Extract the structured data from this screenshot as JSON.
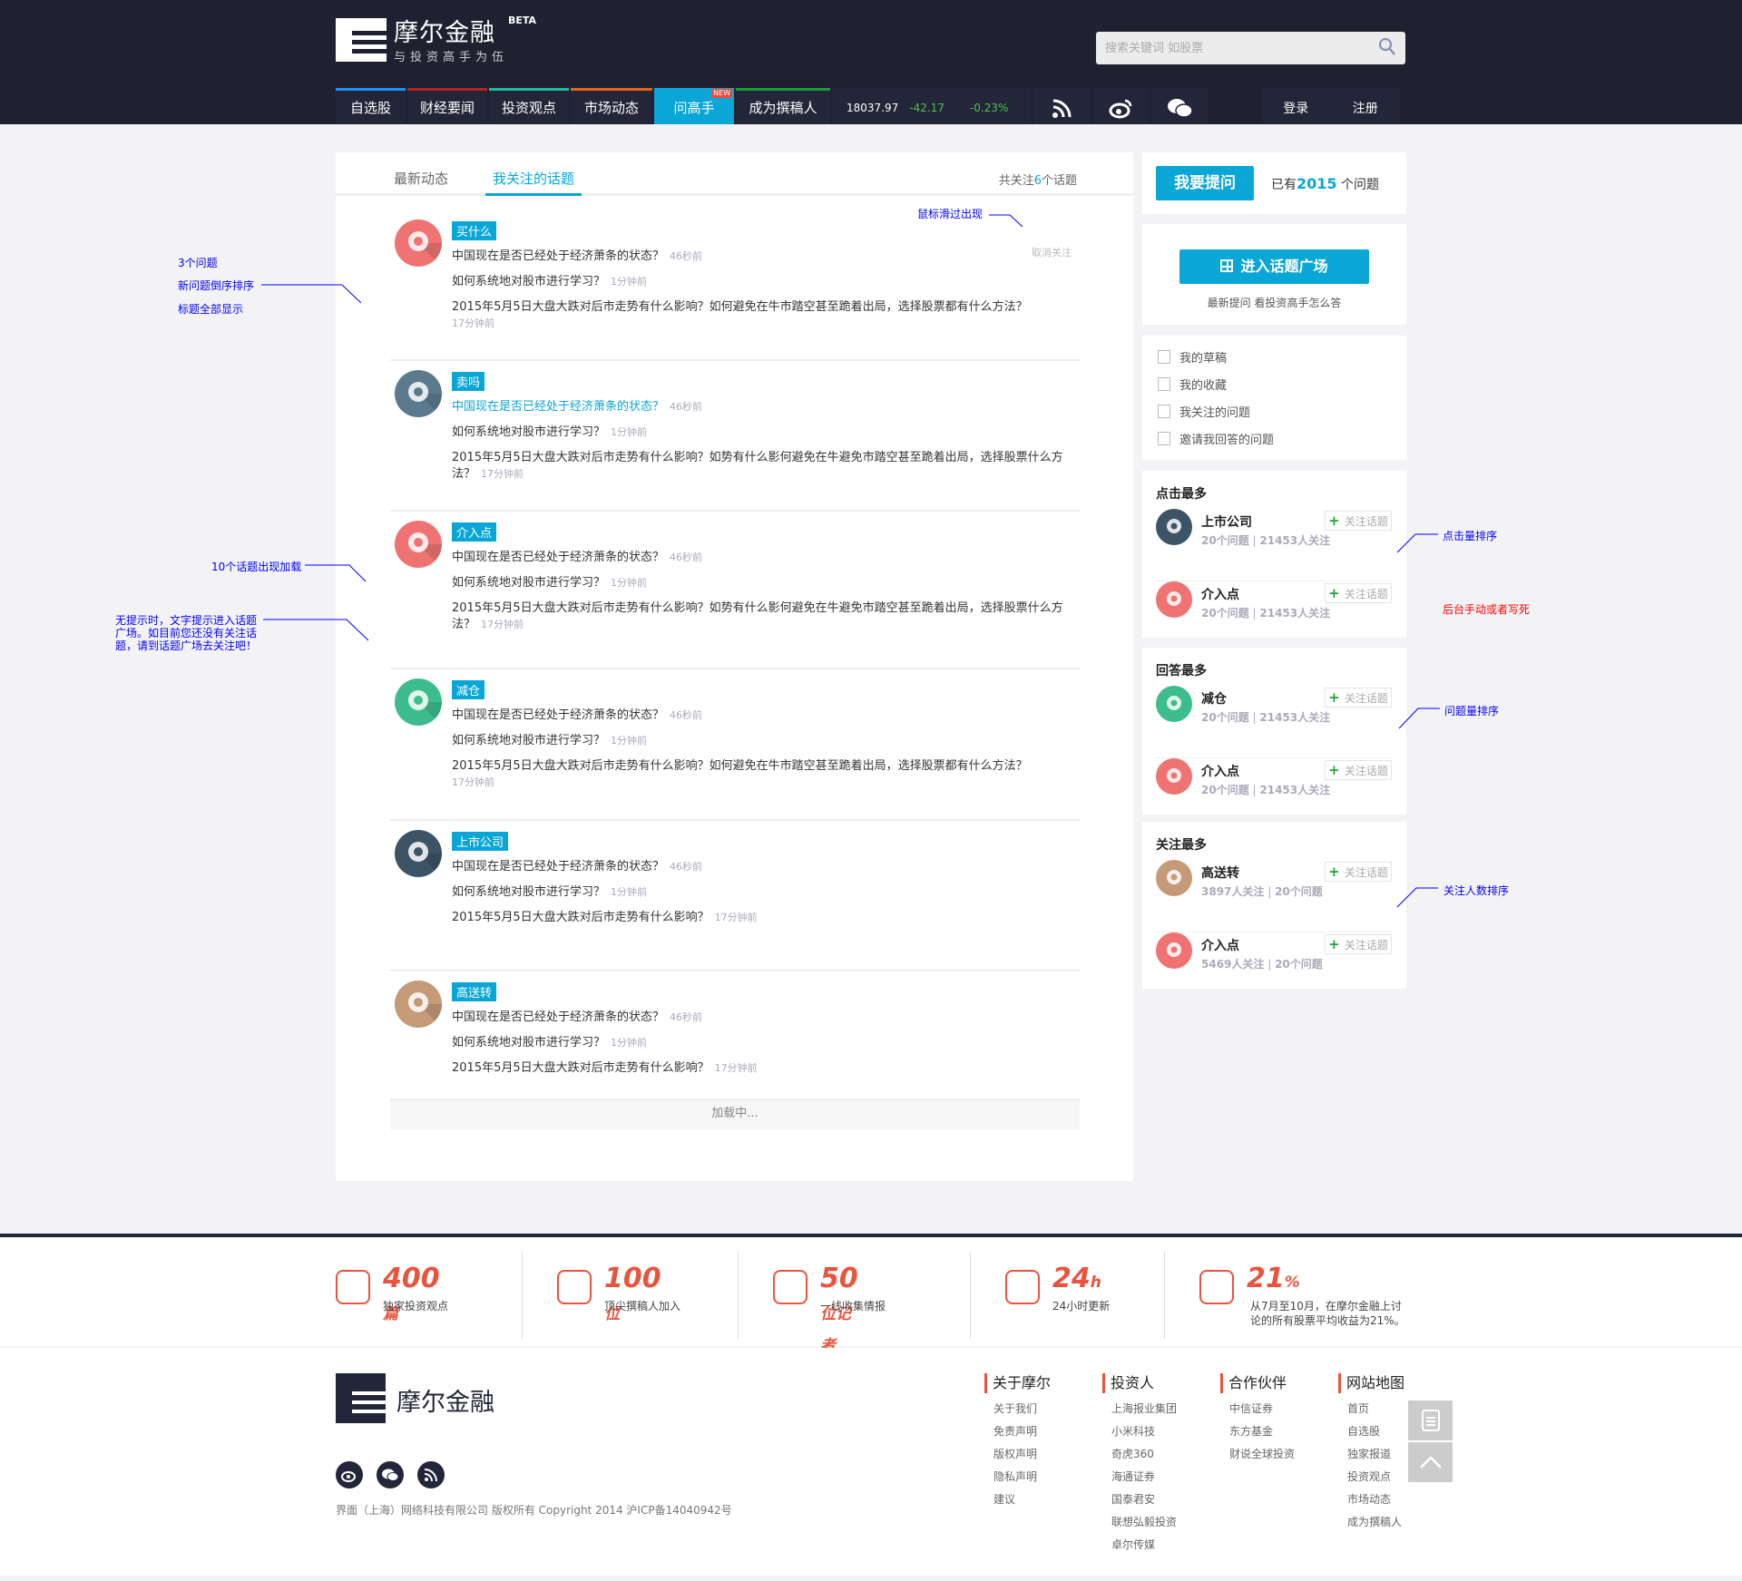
{
  "header": {
    "logo_text": "摩尔金融",
    "logo_badge": "BETA",
    "slogan": "与投资高手为伍",
    "search_placeholder": "搜索关键词 如股票",
    "nav": [
      {
        "label": "自选股",
        "color": "#1e90ff",
        "width": 77
      },
      {
        "label": "财经要闻",
        "color": "#b22222",
        "width": 88
      },
      {
        "label": "投资观点",
        "color": "#1abc9c",
        "width": 88
      },
      {
        "label": "市场动态",
        "color": "#e8631a",
        "width": 90
      },
      {
        "label": "问高手",
        "color": "#0aa6d6",
        "width": 88,
        "badge": "NEW",
        "active": true
      },
      {
        "label": "成为撰稿人",
        "color": "#1a9b3a",
        "width": 104
      }
    ],
    "ticker": {
      "index": "18037.97",
      "change": "-42.17",
      "percent": "-0.23%"
    },
    "login": "登录",
    "register": "注册"
  },
  "main": {
    "tabs": [
      "最新动态",
      "我关注的话题"
    ],
    "follow_prefix": "共关注",
    "follow_count": "6",
    "follow_suffix": "个话题",
    "unfollow": "取消关注",
    "loading": "加载中...",
    "items": [
      {
        "tag": "买什么",
        "icon": "buy-icon",
        "color": "#f07373",
        "qs": [
          {
            "text": "中国现在是否已经处于经济萧条的状态？",
            "time": "46秒前"
          },
          {
            "text": "如何系统地对股市进行学习？",
            "time": "1分钟前"
          },
          {
            "text": "2015年5月5日大盘大跌对后市走势有什么影响？如何避免在牛市踏空甚至跪着出局，选择股票都有什么方法？",
            "time": "17分钟前",
            "wrap": true
          }
        ]
      },
      {
        "tag": "卖吗",
        "icon": "coin-hand-icon",
        "color": "#5b7a8e",
        "hl": true,
        "qs": [
          {
            "text": "中国现在是否已经处于经济萧条的状态？",
            "time": "46秒前"
          },
          {
            "text": "如何系统地对股市进行学习？",
            "time": "1分钟前"
          },
          {
            "text": "2015年5月5日大盘大跌对后市走势有什么影响？如势有什么影何避免在牛避免市踏空甚至跪着出局，选择股票什么方法？",
            "time": "17分钟前",
            "wrap": true
          }
        ]
      },
      {
        "tag": "介入点",
        "icon": "location-dollar-icon",
        "color": "#f07373",
        "qs": [
          {
            "text": "中国现在是否已经处于经济萧条的状态？",
            "time": "46秒前"
          },
          {
            "text": "如何系统地对股市进行学习？",
            "time": "1分钟前"
          },
          {
            "text": "2015年5月5日大盘大跌对后市走势有什么影响？如势有什么影何避免在牛避免市踏空甚至跪着出局，选择股票什么方法？",
            "time": "17分钟前",
            "wrap": true
          }
        ]
      },
      {
        "tag": "减仓",
        "icon": "wallet-coins-icon",
        "color": "#3dbd8e",
        "qs": [
          {
            "text": "中国现在是否已经处于经济萧条的状态？",
            "time": "46秒前"
          },
          {
            "text": "如何系统地对股市进行学习？",
            "time": "1分钟前"
          },
          {
            "text": "2015年5月5日大盘大跌对后市走势有什么影响？如何避免在牛市踏空甚至跪着出局，选择股票都有什么方法？",
            "time": "17分钟前",
            "wrap": true
          }
        ]
      },
      {
        "tag": "上市公司",
        "icon": "globe-icon",
        "color": "#3d5366",
        "qs": [
          {
            "text": "中国现在是否已经处于经济萧条的状态？",
            "time": "46秒前"
          },
          {
            "text": "如何系统地对股市进行学习？",
            "time": "1分钟前"
          },
          {
            "text": "2015年5月5日大盘大跌对后市走势有什么影响？",
            "time": "17分钟前"
          }
        ]
      },
      {
        "tag": "高送转",
        "icon": "gear-cycle-icon",
        "color": "#c49a77",
        "qs": [
          {
            "text": "中国现在是否已经处于经济萧条的状态？",
            "time": "46秒前"
          },
          {
            "text": "如何系统地对股市进行学习？",
            "time": "1分钟前"
          },
          {
            "text": "2015年5月5日大盘大跌对后市走势有什么影响？",
            "time": "17分钟前"
          }
        ]
      }
    ]
  },
  "sidebar": {
    "ask_button": "我要提问",
    "qcount_prefix": "已有",
    "qcount": "2015",
    "qcount_suffix": " 个问题",
    "square_button": "进入话题广场",
    "square_sub": "最新提问 看投资高手怎么答",
    "links": [
      "我的草稿",
      "我的收藏",
      "我关注的问题",
      "邀请我回答的问题"
    ],
    "follow_btn": "关注话题",
    "rankings": [
      {
        "title": "点击最多",
        "rows": [
          {
            "name": "上市公司",
            "color": "#3d5366",
            "a": "20个问题",
            "b": "21453人关注"
          },
          {
            "name": "介入点",
            "color": "#f07373",
            "a": "20个问题",
            "b": "21453人关注"
          }
        ]
      },
      {
        "title": "回答最多",
        "rows": [
          {
            "name": "减仓",
            "color": "#3dbd8e",
            "a": "20个问题",
            "b": "21453人关注"
          },
          {
            "name": "介入点",
            "color": "#f07373",
            "a": "20个问题",
            "b": "21453人关注"
          }
        ]
      },
      {
        "title": "关注最多",
        "rows": [
          {
            "name": "高送转",
            "color": "#c49a77",
            "a": "3897人关注",
            "b": "20个问题"
          },
          {
            "name": "介入点",
            "color": "#f07373",
            "a": "5469人关注",
            "b": "20个问题"
          }
        ]
      }
    ]
  },
  "annotations": {
    "hover": "鼠标滑过出现",
    "left1": [
      "3个问题",
      "新问题倒序排序",
      "标题全部显示"
    ],
    "left2": "10个话题出现加载",
    "left3": "无提示时，文字提示进入话题广场。如目前您还没有关注话题，请到话题广场去关注吧！",
    "click_sort": "点击量排序",
    "manual": "后台手动或者写死",
    "answer_sort": "问题量排序",
    "follow_sort": "关注人数排序"
  },
  "stats": [
    {
      "num": "400",
      "unit": "篇",
      "label": "独家投资观点"
    },
    {
      "num": "100",
      "unit": "位",
      "label": "顶尖撰稿人加入"
    },
    {
      "num": "50",
      "unit": "位记者",
      "label": "一线收集情报"
    },
    {
      "num": "24",
      "unit": "h",
      "label": "24小时更新"
    },
    {
      "num": "21",
      "unit": "%",
      "label": "从7月至10月，在摩尔金融上讨论的所有股票平均收益为21%。"
    }
  ],
  "footer": {
    "logo_text": "摩尔金融",
    "copyright": "界面（上海）网络科技有限公司 版权所有 Copyright 2014 沪ICP备14040942号",
    "cols": [
      {
        "title": "关于摩尔",
        "links": [
          "关于我们",
          "免责声明",
          "版权声明",
          "隐私声明",
          "建议"
        ]
      },
      {
        "title": "投资人",
        "links": [
          "上海报业集团",
          "小米科技",
          "奇虎360",
          "海通证券",
          "国泰君安",
          "联想弘毅投资",
          "卓尔传媒"
        ]
      },
      {
        "title": "合作伙伴",
        "links": [
          "中信证券",
          "东方基金",
          "财说全球投资"
        ]
      },
      {
        "title": "网站地图",
        "links": [
          "首页",
          "自选股",
          "独家报道",
          "投资观点",
          "市场动态",
          "成为撰稿人"
        ]
      }
    ]
  }
}
